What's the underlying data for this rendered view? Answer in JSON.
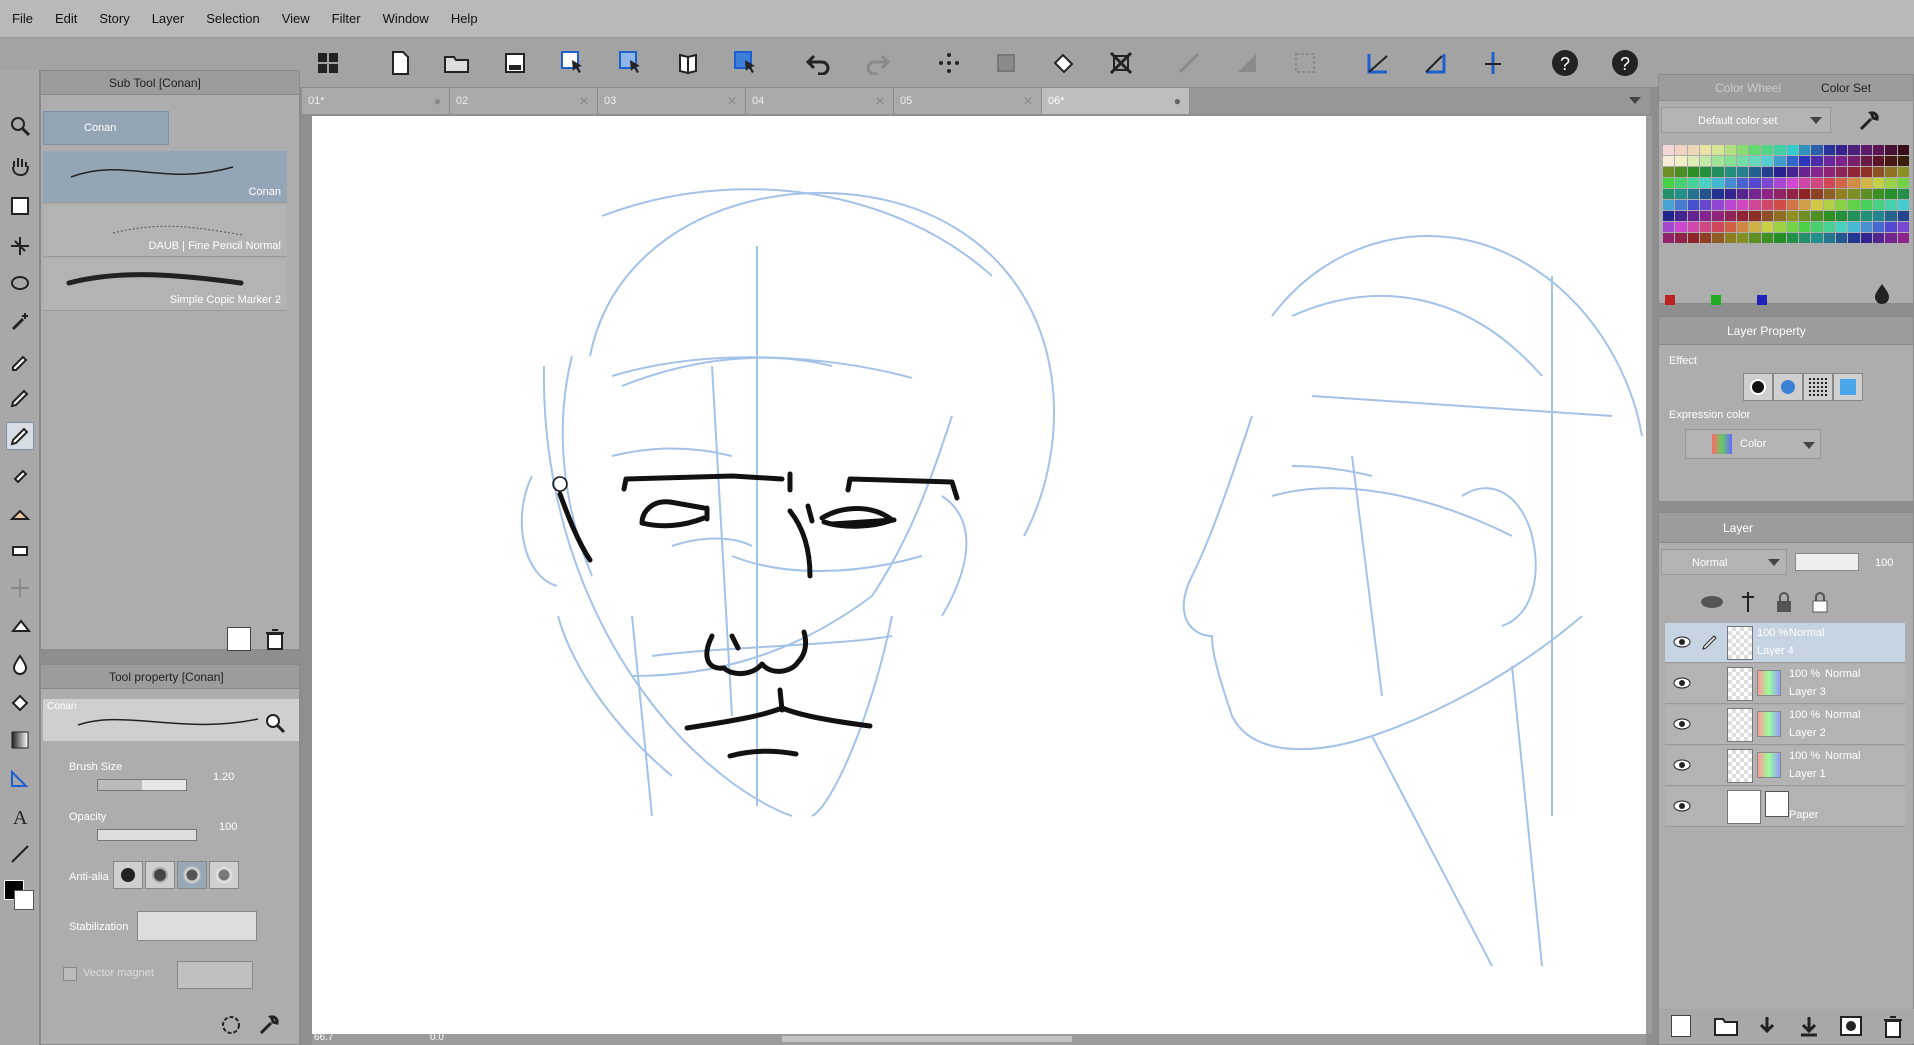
{
  "menu": [
    "File",
    "Edit",
    "Story",
    "Layer",
    "Selection",
    "View",
    "Filter",
    "Window",
    "Help"
  ],
  "subtool": {
    "title": "Sub Tool [Conan]",
    "group": "Conan",
    "items": [
      {
        "label": "Conan"
      },
      {
        "label": "DAUB | Fine Pencil Normal"
      },
      {
        "label": "Simple Copic Marker 2"
      }
    ]
  },
  "toolprop": {
    "title": "Tool property [Conan]",
    "preview_label": "Conan",
    "brush_size_label": "Brush Size",
    "brush_size_value": "1.20",
    "opacity_label": "Opacity",
    "opacity_value": "100",
    "antialias_label": "Anti-alia",
    "stabilization_label": "Stabilization",
    "vector_magnet_label": "Vector magnet"
  },
  "tabs": [
    {
      "label": "01*",
      "active": false
    },
    {
      "label": "02",
      "active": false
    },
    {
      "label": "03",
      "active": false
    },
    {
      "label": "04",
      "active": false
    },
    {
      "label": "05",
      "active": false
    },
    {
      "label": "06*",
      "active": true
    }
  ],
  "status": {
    "zoom": "66.7",
    "angle": "0.0"
  },
  "color": {
    "tab_wheel": "Color Wheel",
    "tab_set": "Color Set",
    "set_name": "Default color set"
  },
  "layer_property": {
    "title": "Layer Property",
    "effect_label": "Effect",
    "expression_label": "Expression color",
    "expression_value": "Color"
  },
  "layers": {
    "title": "Layer",
    "blend_mode": "Normal",
    "opacity": "100",
    "items": [
      {
        "percent": "100 %",
        "mode": "Normal",
        "name": "Layer 4",
        "selected": true
      },
      {
        "percent": "100 %",
        "mode": "Normal",
        "name": "Layer 3",
        "selected": false
      },
      {
        "percent": "100 %",
        "mode": "Normal",
        "name": "Layer 2",
        "selected": false
      },
      {
        "percent": "100 %",
        "mode": "Normal",
        "name": "Layer 1",
        "selected": false
      },
      {
        "percent": "",
        "mode": "",
        "name": "Paper",
        "selected": false
      }
    ]
  }
}
